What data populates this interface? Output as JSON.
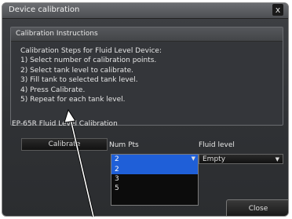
{
  "window": {
    "title": "Device calibration",
    "close_glyph": "x"
  },
  "instructions": {
    "heading": "Calibration Instructions",
    "lines": [
      "Calibration Steps for Fluid Level Device:",
      "1) Select number of calibration points.",
      "2) Select tank level to calibrate.",
      "3) Fill tank to selected tank level.",
      "4) Press Calibrate.",
      "5) Repeat for each tank level."
    ]
  },
  "fluid_section": {
    "heading": "EP-65R Fluid Level Calibration",
    "calibrate_label": "Calibrate",
    "num_pts_label": "Num Pts",
    "fluid_level_label": "Fluid level",
    "num_pts_value": "2",
    "num_pts_options": [
      "2",
      "3",
      "5"
    ],
    "fluid_level_value": "Empty"
  },
  "footer": {
    "close_label": "Close"
  },
  "colors": {
    "highlight": "#1f5fd8",
    "background": "#2f3134"
  }
}
